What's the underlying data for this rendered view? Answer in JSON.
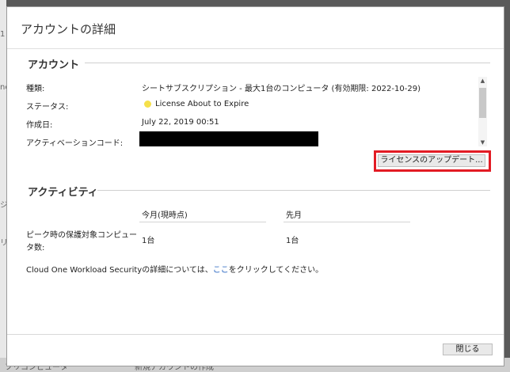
{
  "dialog": {
    "title": "アカウントの詳細",
    "close_label": "閉じる"
  },
  "account": {
    "section_title": "アカウント",
    "type_label": "種類:",
    "type_value": "シートサブスクリプション - 最大1台のコンピュータ (有効期限: 2022-10-29)",
    "status_label": "ステータス:",
    "status_value": "License About to Expire",
    "status_color": "#f5e04a",
    "created_label": "作成日:",
    "created_value": "July 22, 2019 00:51",
    "activation_label": "アクティベーションコード:",
    "update_license_label": "ライセンスのアップデート..."
  },
  "activity": {
    "section_title": "アクティビティ",
    "col_current": "今月(現時点)",
    "col_last": "先月",
    "peak_label_1": "ピーク時の保護対象コンピュー",
    "peak_label_2": "タ数:",
    "peak_current": "1台",
    "peak_last": "1台",
    "info_before": "Cloud One Workload Securityの詳細については、",
    "info_link": "ここ",
    "info_after": "をクリックしてください。"
  },
  "background": {
    "left_snippet_1": "1",
    "left_snippet_2": "nc",
    "left_snippet_3": "ジ",
    "left_snippet_4": "リ",
    "bottom_snippet_1": "フリコンピュータ",
    "bottom_snippet_2": "新規アカウントの作成"
  }
}
